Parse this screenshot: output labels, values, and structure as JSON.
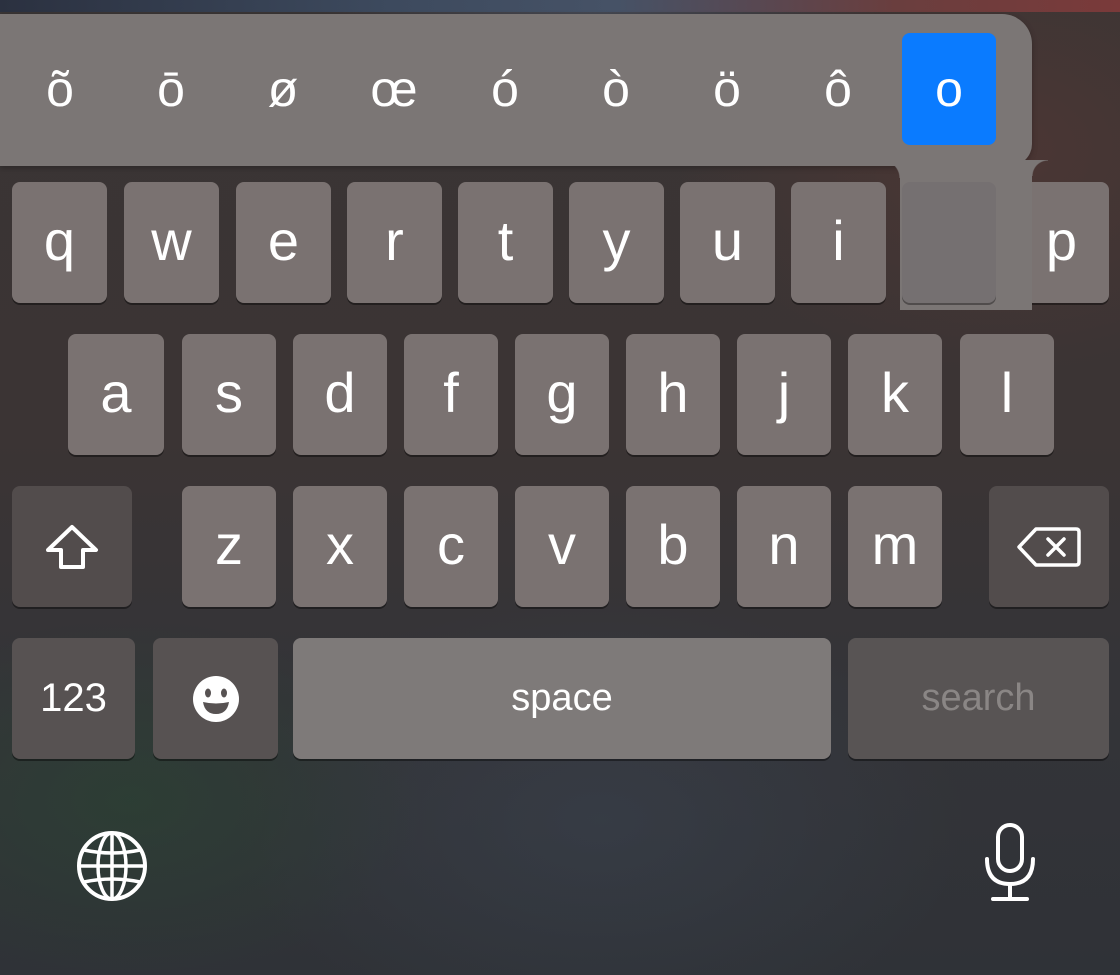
{
  "accent_popup": {
    "options": [
      "õ",
      "ō",
      "ø",
      "œ",
      "ó",
      "ò",
      "ö",
      "ô",
      "o"
    ],
    "selected_index": 8,
    "selected_color": "#0a7bff"
  },
  "rows": {
    "row1": [
      "q",
      "w",
      "e",
      "r",
      "t",
      "y",
      "u",
      "i",
      "p"
    ],
    "row2": [
      "a",
      "s",
      "d",
      "f",
      "g",
      "h",
      "j",
      "k",
      "l"
    ],
    "row3": [
      "z",
      "x",
      "c",
      "v",
      "b",
      "n",
      "m"
    ]
  },
  "bottom_row": {
    "numbers_label": "123",
    "space_label": "space",
    "return_label": "search"
  },
  "icons": {
    "shift": "shift-icon",
    "delete": "backspace-icon",
    "emoji": "emoji-icon",
    "globe": "globe-icon",
    "mic": "microphone-icon"
  },
  "colors": {
    "key": "#7a7271",
    "function_key": "#524c4c",
    "accent_selected": "#0a7bff"
  }
}
